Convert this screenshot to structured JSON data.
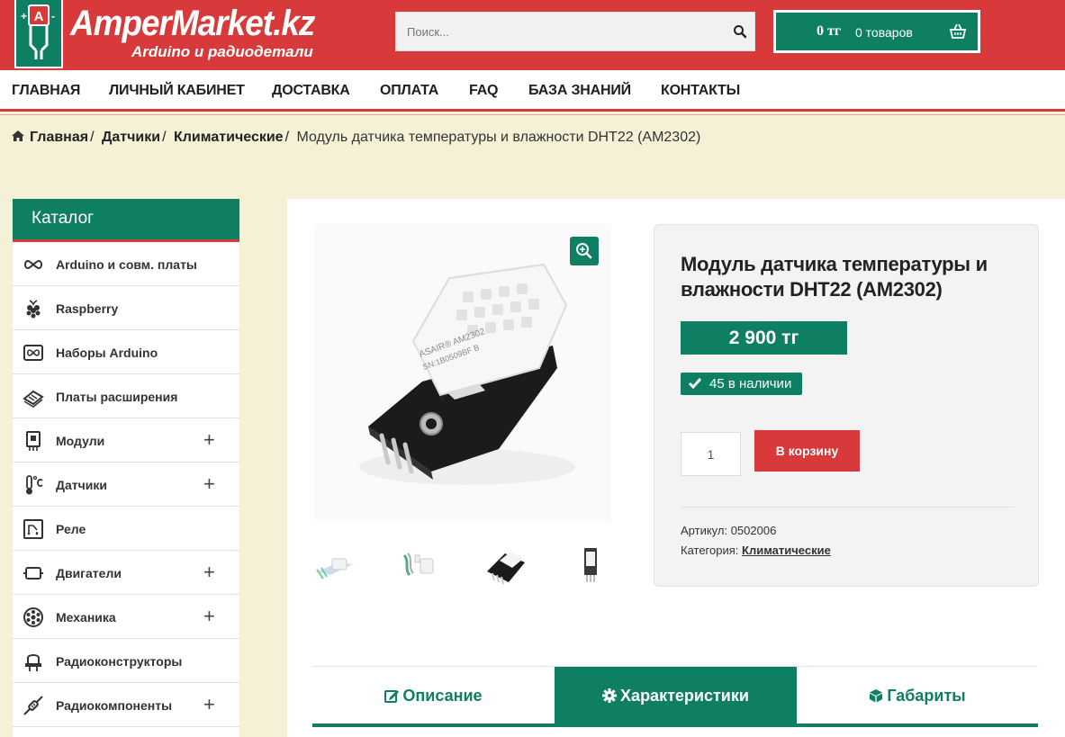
{
  "header": {
    "logo_title": "AmperMarket.kz",
    "logo_subtitle": "Arduino и радиодетали",
    "search_placeholder": "Поиск...",
    "cart_sum": "0 тг",
    "cart_count": "0 товаров"
  },
  "nav": {
    "items": [
      "ГЛАВНАЯ",
      "ЛИЧНЫЙ КАБИНЕТ",
      "ДОСТАВКА",
      "ОПЛАТА",
      "FAQ",
      "БАЗА ЗНАНИЙ",
      "КОНТАКТЫ"
    ]
  },
  "breadcrumb": {
    "items": [
      "Главная",
      "Датчики",
      "Климатические"
    ],
    "current": "Модуль датчика температуры и влажности DHT22 (AM2302)"
  },
  "sidebar": {
    "title": "Каталог",
    "items": [
      {
        "label": "Arduino и совм. платы",
        "icon": "infinity-icon"
      },
      {
        "label": "Raspberry",
        "icon": "raspberry-icon"
      },
      {
        "label": "Наборы Arduino",
        "icon": "kit-icon"
      },
      {
        "label": "Платы расширения",
        "icon": "board-icon"
      },
      {
        "label": "Модули",
        "icon": "module-icon",
        "expandable": "+"
      },
      {
        "label": "Датчики",
        "icon": "thermometer-icon",
        "expandable": "+"
      },
      {
        "label": "Реле",
        "icon": "relay-icon"
      },
      {
        "label": "Двигатели",
        "icon": "motor-icon",
        "expandable": "+"
      },
      {
        "label": "Механика",
        "icon": "gear-wheel-icon",
        "expandable": "+"
      },
      {
        "label": "Радиоконструкторы",
        "icon": "constructor-icon"
      },
      {
        "label": "Радиокомпоненты",
        "icon": "component-icon",
        "expandable": "+"
      }
    ]
  },
  "product": {
    "title": "Модуль датчика температуры и влажности DHT22 (AM2302)",
    "price": "2 900 тг",
    "stock": "45 в наличии",
    "quantity": "1",
    "add_to_cart": "В корзину",
    "sku_label": "Артикул:",
    "sku": "0502006",
    "category_label": "Категория:",
    "category": "Климатические",
    "sensor_print_1": "ASAIR® AM2302",
    "sensor_print_2": "SN:1B0509BF B"
  },
  "tabs": [
    {
      "label": "Описание",
      "icon": "edit-icon"
    },
    {
      "label": "Характеристики",
      "icon": "cog-icon"
    },
    {
      "label": "Габариты",
      "icon": "cube-icon"
    }
  ],
  "colors": {
    "brand_red": "#d8393a",
    "brand_green": "#0f7f63",
    "page_bg": "#f4f1d6"
  }
}
